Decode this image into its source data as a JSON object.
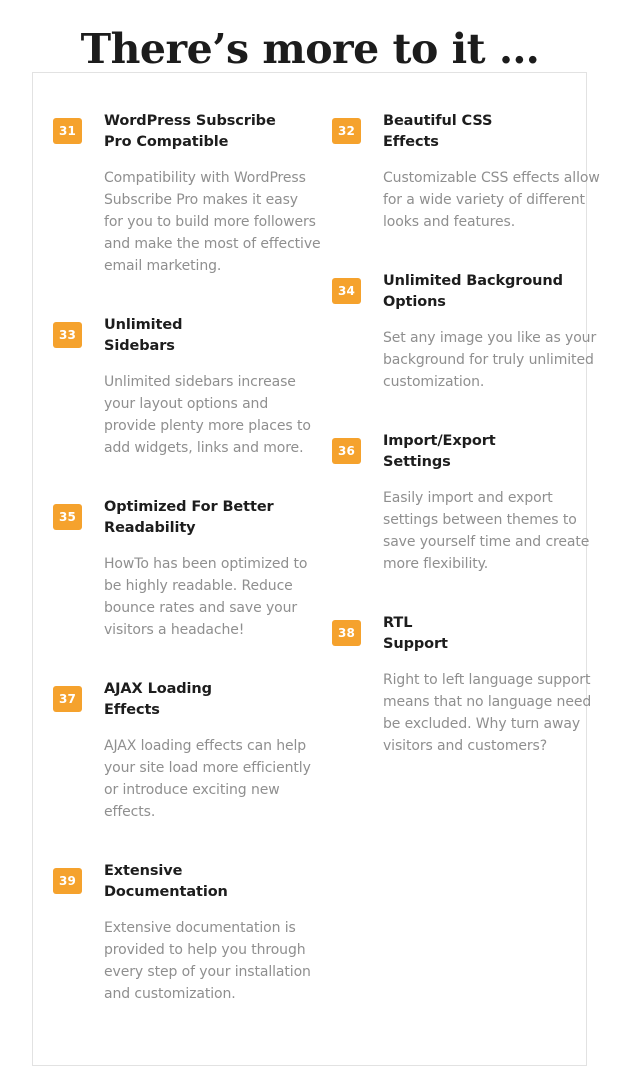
{
  "header": {
    "title": "There’s more to it …"
  },
  "accent_colors": {
    "badge_background": "#f5a22d",
    "badge_text": "#ffffff",
    "panel_border": "#e2e2e2",
    "title_text": "#1c1c1c",
    "feature_title_text": "#1d1d1d",
    "feature_description_text": "#8f8f8f",
    "page_background": "#ffffff"
  },
  "features": {
    "left_column": [
      {
        "number": "31",
        "title": "WordPress Subscribe\nPro Compatible",
        "description": "Compatibility with WordPress Subscribe Pro makes it easy for you to build more followers and make the most of effective email marketing."
      },
      {
        "number": "33",
        "title": "Unlimited\nSidebars",
        "description": "Unlimited sidebars increase your layout options and provide plenty more places to add widgets, links and more."
      },
      {
        "number": "35",
        "title": "Optimized For Better\nReadability",
        "description": "HowTo has been optimized to be highly readable. Reduce bounce rates and save your visitors a headache!"
      },
      {
        "number": "37",
        "title": "AJAX Loading\nEffects",
        "description": "AJAX loading effects can help your site load more efficiently or introduce exciting new effects."
      },
      {
        "number": "39",
        "title": "Extensive\nDocumentation",
        "description": "Extensive documentation is provided to help you through every step of your installation and customization."
      }
    ],
    "right_column": [
      {
        "number": "32",
        "title": "Beautiful CSS\nEffects",
        "description": "Customizable CSS effects allow for a wide variety of different looks and features."
      },
      {
        "number": "34",
        "title": "Unlimited Background\nOptions",
        "description": "Set any image you like as your background for truly unlimited customization."
      },
      {
        "number": "36",
        "title": "Import/Export\nSettings",
        "description": "Easily import and export settings between themes to save yourself time and create more flexibility."
      },
      {
        "number": "38",
        "title": "RTL\nSupport",
        "description": "Right to left language support means that no language need be excluded. Why turn away visitors and customers?"
      }
    ]
  }
}
